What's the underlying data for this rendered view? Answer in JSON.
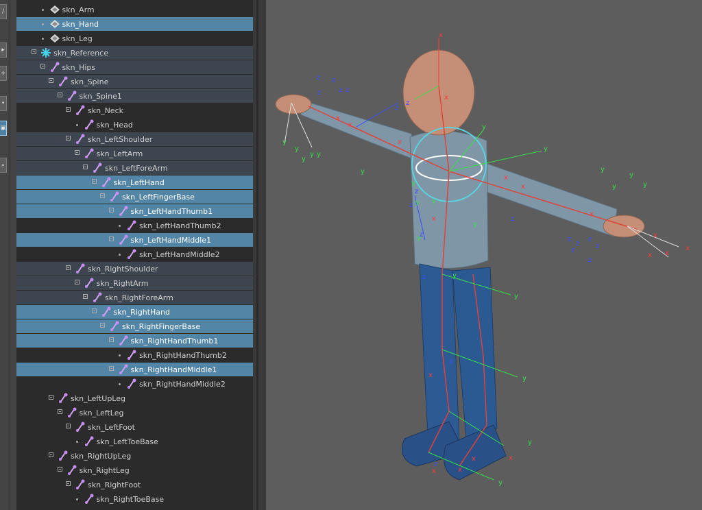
{
  "outliner": {
    "items": [
      {
        "label": "skn_Arm",
        "depth": 2,
        "icon": "display-layer-icon",
        "expand": false,
        "state": ""
      },
      {
        "label": "skn_Hand",
        "depth": 2,
        "icon": "display-layer-icon",
        "expand": false,
        "state": "sel"
      },
      {
        "label": "skn_Leg",
        "depth": 2,
        "icon": "display-layer-icon",
        "expand": false,
        "state": ""
      },
      {
        "label": "skn_Reference",
        "depth": 1,
        "icon": "reference-star-icon",
        "expand": true,
        "state": "mid"
      },
      {
        "label": "skn_Hips",
        "depth": 2,
        "icon": "joint-icon",
        "expand": true,
        "state": "mid"
      },
      {
        "label": "skn_Spine",
        "depth": 3,
        "icon": "joint-icon",
        "expand": true,
        "state": "mid"
      },
      {
        "label": "skn_Spine1",
        "depth": 4,
        "icon": "joint-icon",
        "expand": true,
        "state": "mid"
      },
      {
        "label": "skn_Neck",
        "depth": 5,
        "icon": "joint-icon",
        "expand": true,
        "state": ""
      },
      {
        "label": "skn_Head",
        "depth": 6,
        "icon": "joint-icon",
        "expand": false,
        "state": ""
      },
      {
        "label": "skn_LeftShoulder",
        "depth": 5,
        "icon": "joint-icon",
        "expand": true,
        "state": "mid"
      },
      {
        "label": "skn_LeftArm",
        "depth": 6,
        "icon": "joint-icon",
        "expand": true,
        "state": "mid"
      },
      {
        "label": "skn_LeftForeArm",
        "depth": 7,
        "icon": "joint-icon",
        "expand": true,
        "state": "mid"
      },
      {
        "label": "skn_LeftHand",
        "depth": 8,
        "icon": "joint-icon",
        "expand": true,
        "state": "sel"
      },
      {
        "label": "skn_LeftFingerBase",
        "depth": 9,
        "icon": "joint-icon",
        "expand": true,
        "state": "sel"
      },
      {
        "label": "skn_LeftHandThumb1",
        "depth": 10,
        "icon": "joint-icon",
        "expand": true,
        "state": "sel"
      },
      {
        "label": "skn_LeftHandThumb2",
        "depth": 11,
        "icon": "joint-icon",
        "expand": false,
        "state": ""
      },
      {
        "label": "skn_LeftHandMiddle1",
        "depth": 10,
        "icon": "joint-icon",
        "expand": true,
        "state": "sel"
      },
      {
        "label": "skn_LeftHandMiddle2",
        "depth": 11,
        "icon": "joint-icon",
        "expand": false,
        "state": ""
      },
      {
        "label": "skn_RightShoulder",
        "depth": 5,
        "icon": "joint-icon",
        "expand": true,
        "state": "mid"
      },
      {
        "label": "skn_RightArm",
        "depth": 6,
        "icon": "joint-icon",
        "expand": true,
        "state": "mid"
      },
      {
        "label": "skn_RightForeArm",
        "depth": 7,
        "icon": "joint-icon",
        "expand": true,
        "state": "mid"
      },
      {
        "label": "skn_RightHand",
        "depth": 8,
        "icon": "joint-icon",
        "expand": true,
        "state": "sel"
      },
      {
        "label": "skn_RightFingerBase",
        "depth": 9,
        "icon": "joint-icon",
        "expand": true,
        "state": "sel"
      },
      {
        "label": "skn_RightHandThumb1",
        "depth": 10,
        "icon": "joint-icon",
        "expand": true,
        "state": "sel"
      },
      {
        "label": "skn_RightHandThumb2",
        "depth": 11,
        "icon": "joint-icon",
        "expand": false,
        "state": ""
      },
      {
        "label": "skn_RightHandMiddle1",
        "depth": 10,
        "icon": "joint-icon",
        "expand": true,
        "state": "sel"
      },
      {
        "label": "skn_RightHandMiddle2",
        "depth": 11,
        "icon": "joint-icon",
        "expand": false,
        "state": ""
      },
      {
        "label": "skn_LeftUpLeg",
        "depth": 3,
        "icon": "joint-icon",
        "expand": true,
        "state": ""
      },
      {
        "label": "skn_LeftLeg",
        "depth": 4,
        "icon": "joint-icon",
        "expand": true,
        "state": ""
      },
      {
        "label": "skn_LeftFoot",
        "depth": 5,
        "icon": "joint-icon",
        "expand": true,
        "state": ""
      },
      {
        "label": "skn_LeftToeBase",
        "depth": 6,
        "icon": "joint-icon",
        "expand": false,
        "state": ""
      },
      {
        "label": "skn_RightUpLeg",
        "depth": 3,
        "icon": "joint-icon",
        "expand": true,
        "state": ""
      },
      {
        "label": "skn_RightLeg",
        "depth": 4,
        "icon": "joint-icon",
        "expand": true,
        "state": ""
      },
      {
        "label": "skn_RightFoot",
        "depth": 5,
        "icon": "joint-icon",
        "expand": true,
        "state": ""
      },
      {
        "label": "skn_RightToeBase",
        "depth": 6,
        "icon": "joint-icon",
        "expand": false,
        "state": ""
      }
    ]
  },
  "toolbar": {
    "icons": [
      "brush-icon",
      "select-arrow-icon",
      "move-tool-icon",
      "rotate-tool-icon",
      "camera-icon",
      "magnifier-icon"
    ]
  },
  "viewport": {
    "axis_labels": {
      "x": "x",
      "y": "y",
      "z": "z"
    },
    "colors": {
      "background": "#5d5d5d",
      "shirt": "#7f96a6",
      "jeans": "#2e5a93",
      "skin": "#c48f76",
      "joint": "#e0423a",
      "x_axis": "#ff3a3a",
      "y_axis": "#35e04a",
      "z_axis": "#3a4dff"
    }
  }
}
